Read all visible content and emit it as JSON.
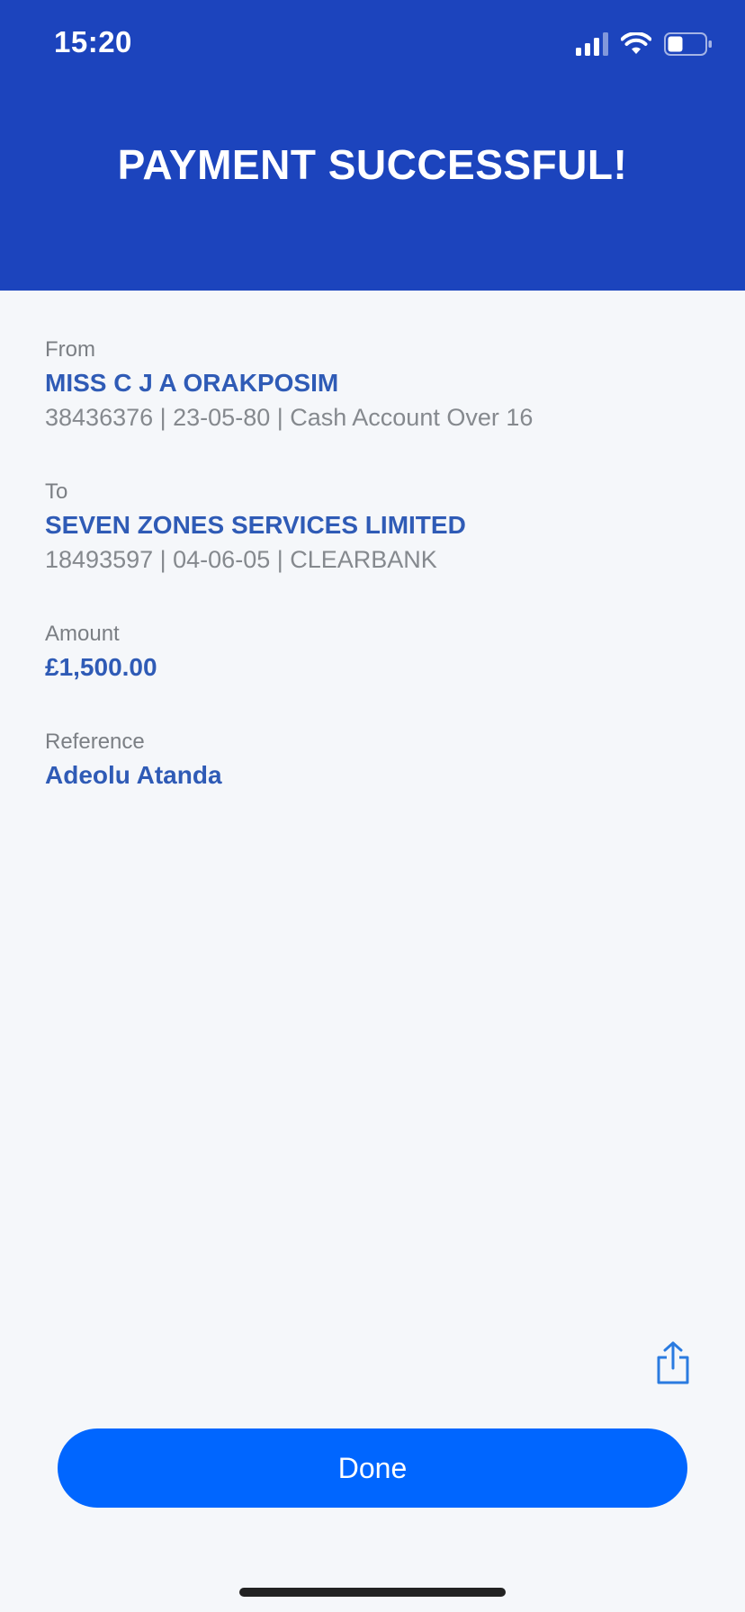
{
  "status_bar": {
    "time": "15:20",
    "icons": [
      "signal-icon",
      "wifi-icon",
      "battery-icon"
    ]
  },
  "header": {
    "title": "PAYMENT SUCCESSFUL!",
    "background_color": "#1c44bd"
  },
  "from": {
    "label": "From",
    "name": "MISS C J A ORAKPOSIM",
    "details": "38436376 | 23-05-80 | Cash Account Over 16"
  },
  "to": {
    "label": "To",
    "name": "SEVEN ZONES SERVICES LIMITED",
    "details": "18493597 | 04-06-05 | CLEARBANK"
  },
  "amount": {
    "label": "Amount",
    "value": "£1,500.00"
  },
  "reference": {
    "label": "Reference",
    "value": "Adeolu Atanda"
  },
  "actions": {
    "share_icon": "share-icon",
    "done_label": "Done",
    "done_color": "#0066ff"
  },
  "colors": {
    "accent_text": "#2f5bb6",
    "muted_text": "#7b7f84",
    "page_background": "#f5f7fa"
  }
}
